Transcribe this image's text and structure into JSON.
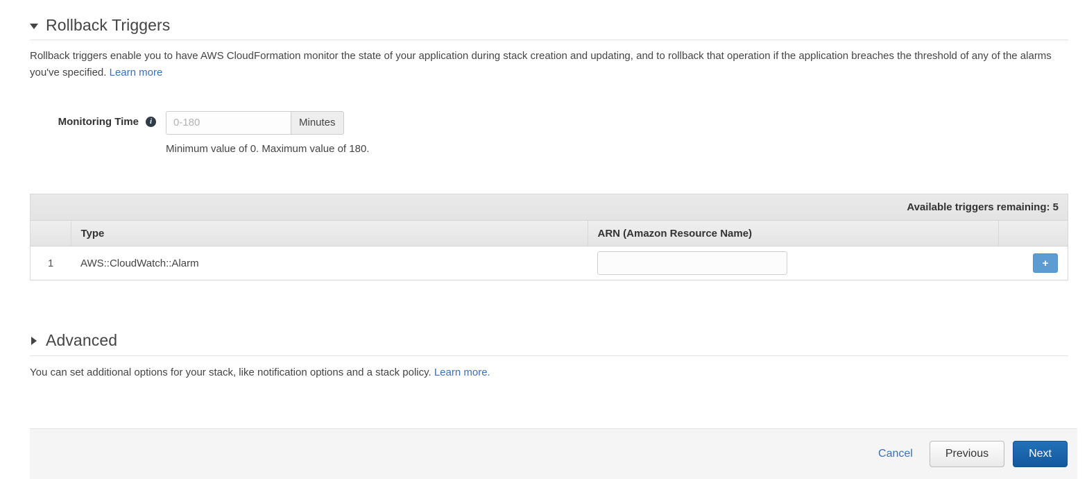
{
  "rollback_section": {
    "title": "Rollback Triggers",
    "expanded": true,
    "caret_icon": "caret-down-icon",
    "description_part1": "Rollback triggers enable you to have AWS CloudFormation monitor the state of your application during stack creation and updating, and to rollback that operation if the application breaches the threshold of any of the alarms you've specified. ",
    "learn_more_label": "Learn more"
  },
  "monitoring_time": {
    "label": "Monitoring Time",
    "info_icon": "info-icon",
    "info_glyph": "i",
    "input_value": "",
    "input_placeholder": "0-180",
    "addon_label": "Minutes",
    "help_text": "Minimum value of 0. Maximum value of 180."
  },
  "triggers_table": {
    "remaining_label": "Available triggers remaining: 5",
    "columns": [
      "",
      "Type",
      "ARN (Amazon Resource Name)",
      ""
    ],
    "rows": [
      {
        "index": "1",
        "type": "AWS::CloudWatch::Alarm",
        "arn_value": "",
        "arn_placeholder": "",
        "add_button_label": "+"
      }
    ]
  },
  "advanced_section": {
    "title": "Advanced",
    "expanded": false,
    "caret_icon": "caret-right-icon",
    "description_part1": "You can set additional options for your stack, like notification options and a stack policy. ",
    "learn_more_label": "Learn more."
  },
  "footer": {
    "cancel_label": "Cancel",
    "previous_label": "Previous",
    "next_label": "Next"
  },
  "colors": {
    "link": "#3c6fb5",
    "primary_button": "#14599f",
    "add_button": "#5d9cd2",
    "footer_bg": "#f5f5f5"
  }
}
